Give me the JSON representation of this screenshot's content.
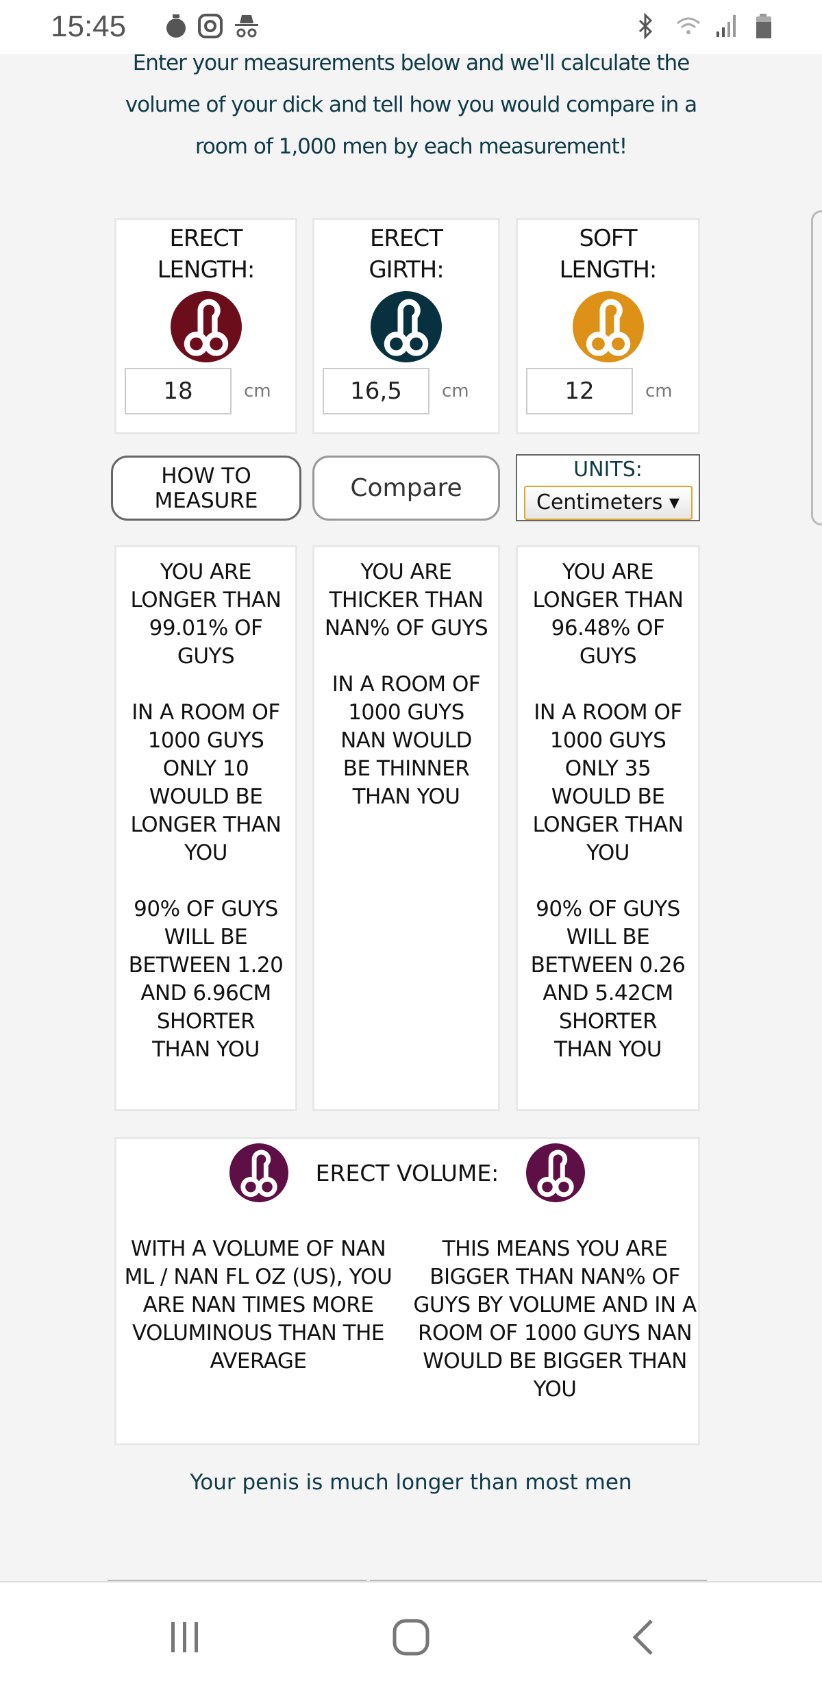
{
  "status_bar": {
    "time": "15:45",
    "icons": [
      "stopwatch-icon",
      "instagram-icon",
      "incognito-icon",
      "bluetooth-icon",
      "wifi-icon",
      "signal-icon",
      "battery-icon"
    ]
  },
  "intro": "Enter your measurements below and we'll calculate the volume of your dick and tell how you would compare in a room of 1,000 men by each measurement!",
  "inputs": [
    {
      "title": "ERECT LENGTH:",
      "value": "18",
      "unit": "cm",
      "color": "#6b0d1a"
    },
    {
      "title": "ERECT GIRTH:",
      "value": "16,5",
      "unit": "cm",
      "color": "#08313f"
    },
    {
      "title": "SOFT LENGTH:",
      "value": "12",
      "unit": "cm",
      "color": "#dd9117"
    }
  ],
  "buttons": {
    "how_to": "HOW TO MEASURE",
    "compare": "Compare"
  },
  "units": {
    "label": "UNITS:",
    "selected": "Centimeters ▾"
  },
  "results": [
    [
      "YOU ARE LONGER THAN 99.01% OF GUYS",
      "IN A ROOM OF 1000 GUYS ONLY 10 WOULD BE LONGER THAN YOU",
      "90% OF GUYS WILL BE BETWEEN 1.20 AND 6.96CM SHORTER THAN YOU"
    ],
    [
      "YOU ARE THICKER THAN NAN% OF GUYS",
      "IN A ROOM OF 1000 GUYS NAN WOULD BE THINNER THAN YOU"
    ],
    [
      "YOU ARE LONGER THAN 96.48% OF GUYS",
      "IN A ROOM OF 1000 GUYS ONLY 35 WOULD BE LONGER THAN YOU",
      "90% OF GUYS WILL BE BETWEEN 0.26 AND 5.42CM SHORTER THAN YOU"
    ]
  ],
  "volume": {
    "title": "ERECT VOLUME:",
    "color": "#5e0f45",
    "left": "WITH A VOLUME OF NAN ML / NAN FL OZ (US), YOU ARE NAN TIMES MORE VOLUMINOUS THAN THE AVERAGE",
    "right": "THIS MEANS YOU ARE BIGGER THAN NAN% OF GUYS BY VOLUME AND IN A ROOM OF 1000 GUYS NAN WOULD BE BIGGER THAN YOU"
  },
  "verdict": "Your penis is much longer than most men",
  "nav": [
    "recent-apps-icon",
    "home-icon",
    "back-icon"
  ]
}
